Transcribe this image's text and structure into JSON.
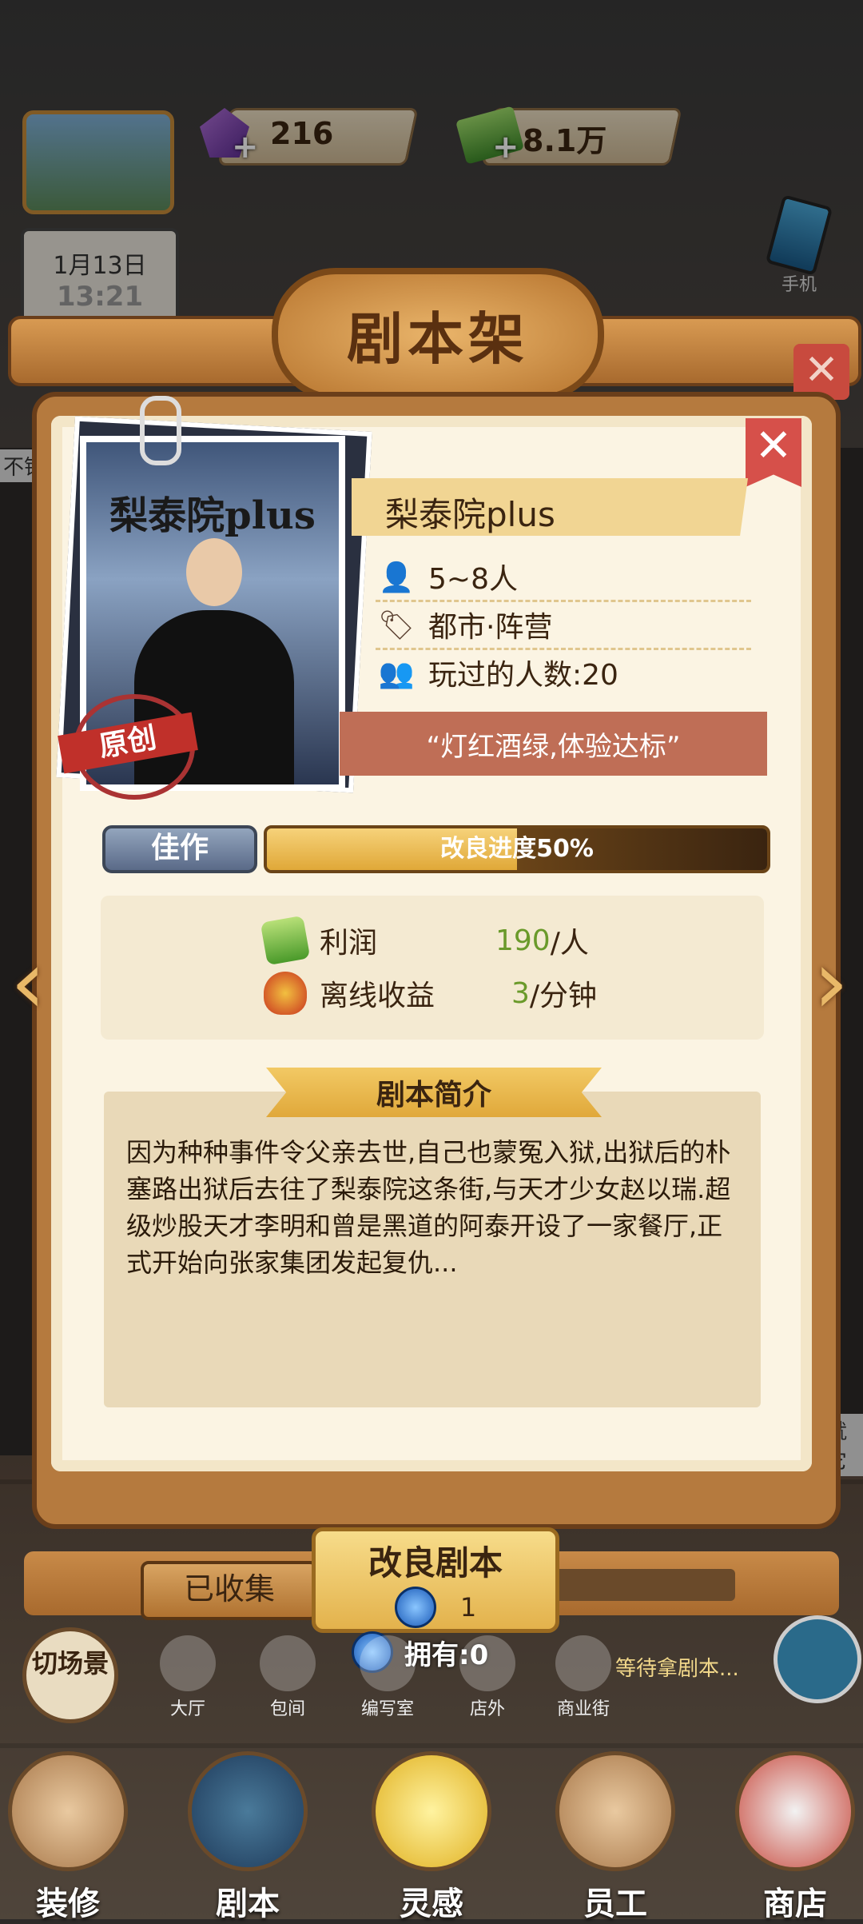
{
  "topbar": {
    "gems": "216",
    "cash": "8.1万",
    "date": "1月13日",
    "time": "13:21",
    "phone_label": "手机",
    "left_hint": "不错",
    "right_hint": "就它"
  },
  "shelf_title": "剧本架",
  "script": {
    "poster_title": "梨泰院plus",
    "stamp": "原创",
    "name": "梨泰院plus",
    "players": "5~8人",
    "genre": "都市·阵营",
    "played_count": "玩过的人数:20",
    "quote": "“灯红酒绿,体验达标”",
    "grade": "佳作",
    "progress_label": "改良进度50%",
    "progress_fraction": 0.5,
    "profit_label": "利润",
    "profit_value": "190",
    "profit_unit": "/人",
    "offline_label": "离线收益",
    "offline_value": "3",
    "offline_unit": "/分钟",
    "intro_title": "剧本简介",
    "intro_text": "因为种种事件令父亲去世,自己也蒙冤入狱,出狱后的朴塞路出狱后去往了梨泰院这条街,与天才少女赵以瑞.超级炒股天才李明和曾是黑道的阿泰开设了一家餐厅,正式开始向张家集团发起复仇..."
  },
  "actions": {
    "collected": "已收集",
    "improve": "改良剧本",
    "improve_cost": "1",
    "owned": "拥有:0",
    "switch_scene": "切场景",
    "ticker": "等待拿剧本..."
  },
  "nav_small": [
    {
      "label": "大厅",
      "icon": "hall-icon"
    },
    {
      "label": "包间",
      "icon": "room-icon"
    },
    {
      "label": "编写室",
      "icon": "writing-icon"
    },
    {
      "label": "店外",
      "icon": "outside-icon"
    },
    {
      "label": "商业街",
      "icon": "street-icon"
    }
  ],
  "nav_bottom": [
    {
      "label": "装修",
      "icon": "decorate-icon"
    },
    {
      "label": "剧本",
      "icon": "script-book-icon"
    },
    {
      "label": "灵感",
      "icon": "inspiration-icon"
    },
    {
      "label": "员工",
      "icon": "staff-icon"
    },
    {
      "label": "商店",
      "icon": "shop-icon"
    }
  ],
  "colors": {
    "card_bg": "#fbf4e3",
    "frame": "#b57a3e",
    "quote_band": "#bf6e56",
    "accent_green": "#6a9a2a",
    "close_red": "#d6504a"
  }
}
